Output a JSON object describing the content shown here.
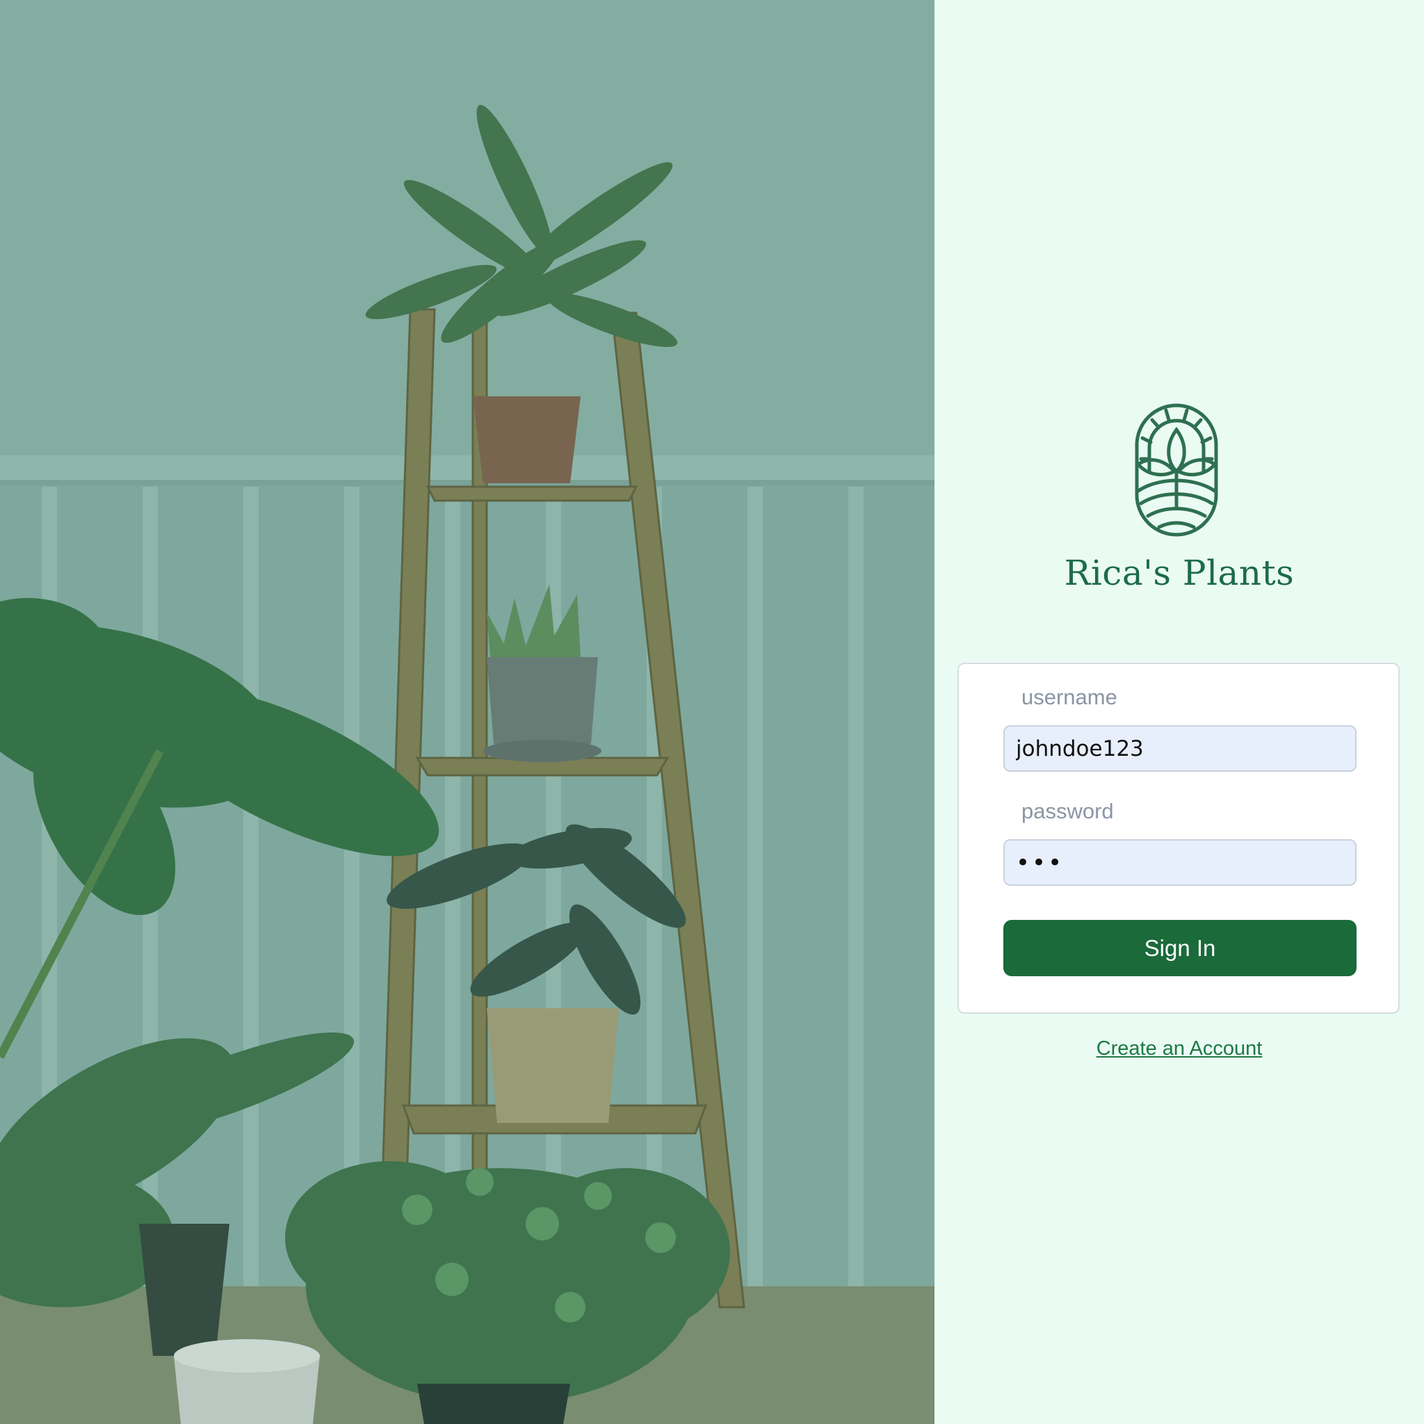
{
  "hero": {
    "image": "plants-on-wooden-ladder-shelf-photo"
  },
  "brand": {
    "name": "Rica's Plants",
    "logo_icon": "leaf-arch-logo"
  },
  "form": {
    "username_label": "username",
    "username_value": "johndoe123",
    "password_label": "password",
    "password_value": "•••",
    "submit_label": "Sign In"
  },
  "links": {
    "create_account": "Create an Account"
  },
  "colors": {
    "accent": "#1a6a3a",
    "brand_text": "#1d6b4a",
    "panel_bg": "#eafbf3",
    "input_bg": "#e8effc"
  }
}
